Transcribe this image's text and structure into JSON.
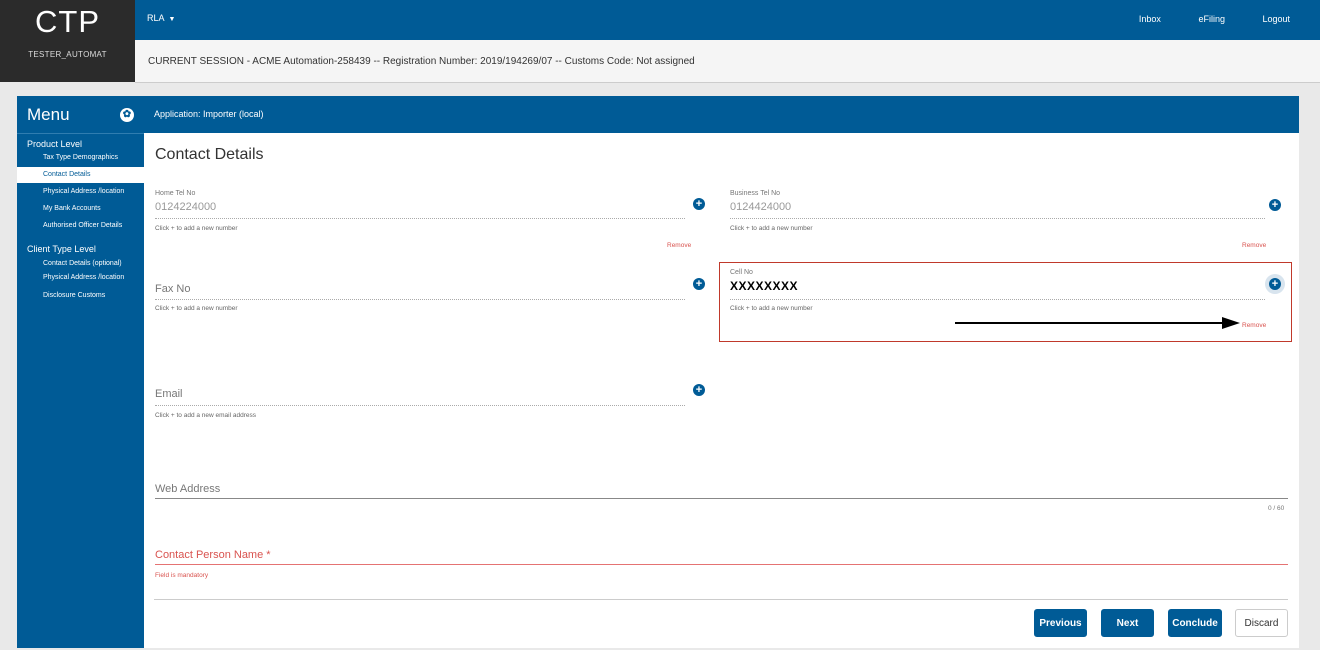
{
  "header": {
    "logo": "CTP",
    "user": "TESTER_AUTOMAT",
    "rla_menu": "RLA",
    "links": {
      "inbox": "Inbox",
      "efiling": "eFiling",
      "logout": "Logout"
    },
    "session": "CURRENT SESSION - ACME Automation-258439 -- Registration Number: 2019/194269/07 -- Customs Code: Not assigned"
  },
  "sidebar": {
    "title": "Menu",
    "product_level": "Product Level",
    "product_items": [
      "Tax Type Demographics",
      "Contact Details",
      "Physical Address /location",
      "My Bank Accounts",
      "Authorised Officer Details"
    ],
    "client_level": "Client Type Level",
    "client_items": [
      "Contact Details (optional)",
      "Physical Address /location",
      "Disclosure Customs"
    ]
  },
  "app_bar": "Application: Importer (local)",
  "form": {
    "heading": "Contact Details",
    "home_tel": {
      "label": "Home Tel No",
      "value": "0124224000",
      "hint": "Click + to add a new number",
      "remove": "Remove"
    },
    "business_tel": {
      "label": "Business Tel No",
      "value": "0124424000",
      "hint": "Click + to add a new number",
      "remove": "Remove"
    },
    "fax": {
      "label": "Fax No",
      "hint": "Click + to add a new number"
    },
    "cell": {
      "label": "Cell No",
      "value": "XXXXXXXX",
      "hint": "Click + to add a new number",
      "remove": "Remove"
    },
    "email": {
      "label": "Email",
      "hint": "Click + to add a new email address"
    },
    "web": {
      "label": "Web Address",
      "counter": "0 / 60"
    },
    "contact_person": {
      "label": "Contact Person Name *",
      "error": "Field is mandatory"
    }
  },
  "buttons": {
    "previous": "Previous",
    "next": "Next",
    "conclude": "Conclude",
    "discard": "Discard"
  },
  "colors": {
    "primary": "#005b96",
    "error": "#d9534f",
    "highlight": "#c0392b"
  }
}
